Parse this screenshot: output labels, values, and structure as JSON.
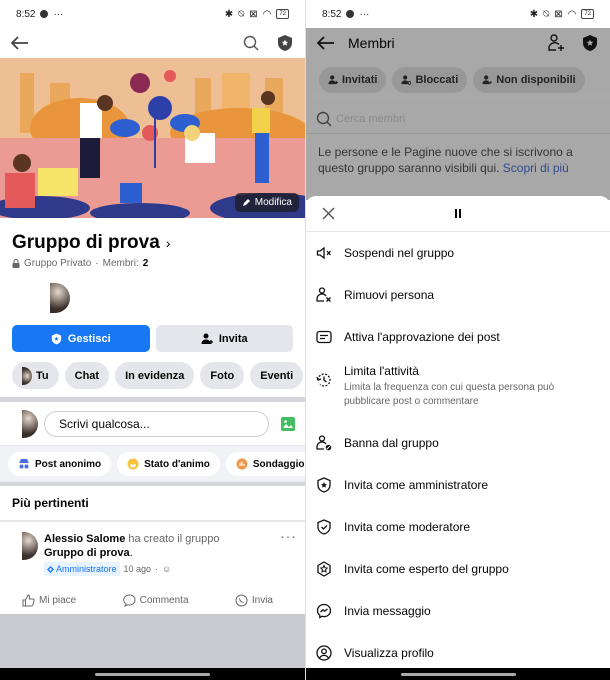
{
  "status_bar": {
    "time": "8:52",
    "dots": "···",
    "battery": "72"
  },
  "left": {
    "cover": {
      "edit_label": "Modifica"
    },
    "group": {
      "name": "Gruppo di prova",
      "privacy": "Gruppo Privato",
      "members_label": "Membri:",
      "members_count": "2"
    },
    "actions": {
      "manage_label": "Gestisci",
      "invite_label": "Invita"
    },
    "chips": [
      "Tu",
      "Chat",
      "In evidenza",
      "Foto",
      "Eventi"
    ],
    "composer": {
      "placeholder": "Scrivi qualcosa..."
    },
    "post_types": [
      "Post anonimo",
      "Stato d'animo",
      "Sondaggio"
    ],
    "feed_heading": "Più pertinenti",
    "post": {
      "author": "Alessio Salome",
      "action_text": "ha creato il gruppo",
      "group_name": "Gruppo di prova",
      "badge": "Amministratore",
      "time": "10 ago",
      "more": "···"
    },
    "reactions": [
      "Mi piace",
      "Commenta",
      "Invia"
    ]
  },
  "right": {
    "header_title": "Membri",
    "filters": [
      "Invitati",
      "Bloccati",
      "Non disponibili"
    ],
    "search_placeholder": "Cerca membri",
    "info_text": "Le persone e le Pagine nuove che si iscrivono a questo gruppo saranno visibili qui.",
    "info_link": "Scopri di più",
    "menu": [
      {
        "label": "Sospendi nel gruppo",
        "icon": "mute-icon"
      },
      {
        "label": "Rimuovi persona",
        "icon": "remove-person-icon"
      },
      {
        "label": "Attiva l'approvazione dei post",
        "icon": "post-approval-icon"
      },
      {
        "label": "Limita l'attività",
        "sub": "Limita la frequenza con cui questa persona può pubblicare post o commentare",
        "icon": "limit-activity-icon"
      },
      {
        "label": "Banna dal gruppo",
        "icon": "ban-person-icon"
      },
      {
        "label": "Invita come amministratore",
        "icon": "admin-shield-icon"
      },
      {
        "label": "Invita come moderatore",
        "icon": "moderator-shield-icon"
      },
      {
        "label": "Invita come esperto del gruppo",
        "icon": "expert-badge-icon"
      },
      {
        "label": "Invia messaggio",
        "icon": "messenger-icon"
      },
      {
        "label": "Visualizza profilo",
        "icon": "profile-icon"
      }
    ]
  }
}
